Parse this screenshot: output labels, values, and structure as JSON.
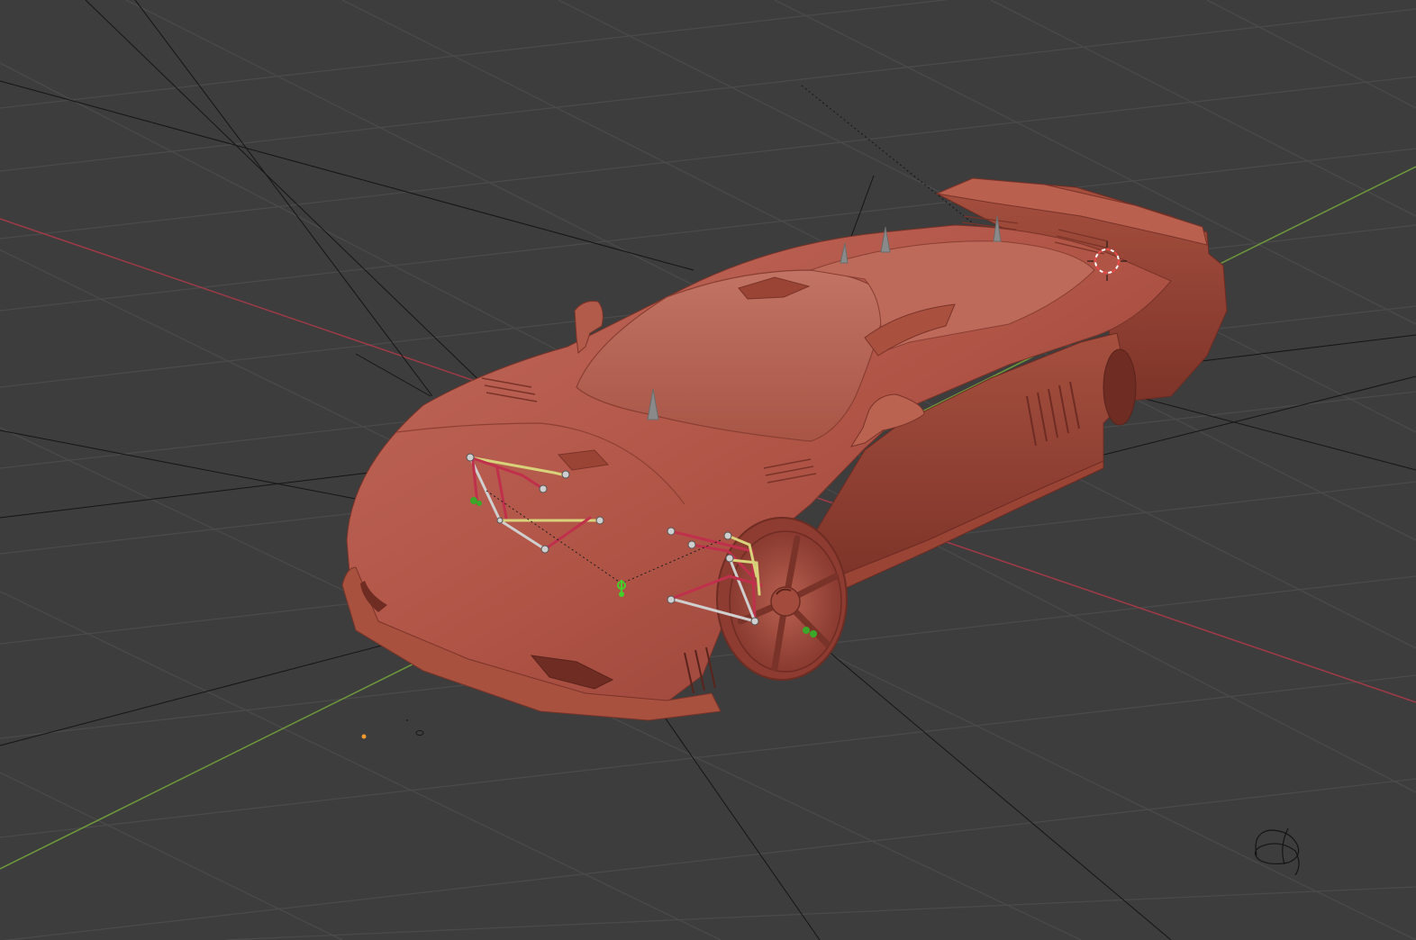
{
  "viewport": {
    "mode": "3d-viewport",
    "object": "car-body",
    "colors": {
      "background": "#3d3d3d",
      "grid_line": "#4b4b4b",
      "x_axis": "#a03a48",
      "y_axis": "#6f9a3a",
      "car_body": "#b45a4c",
      "rig_red": "#c0304c",
      "rig_yellow": "#d8d27a",
      "rig_white": "#cfcfcf",
      "control_green": "#44d02a"
    },
    "icons": [
      "3d-cursor-icon",
      "light-icon",
      "camera-icon",
      "bone-handle-icon",
      "empty-icon"
    ]
  }
}
